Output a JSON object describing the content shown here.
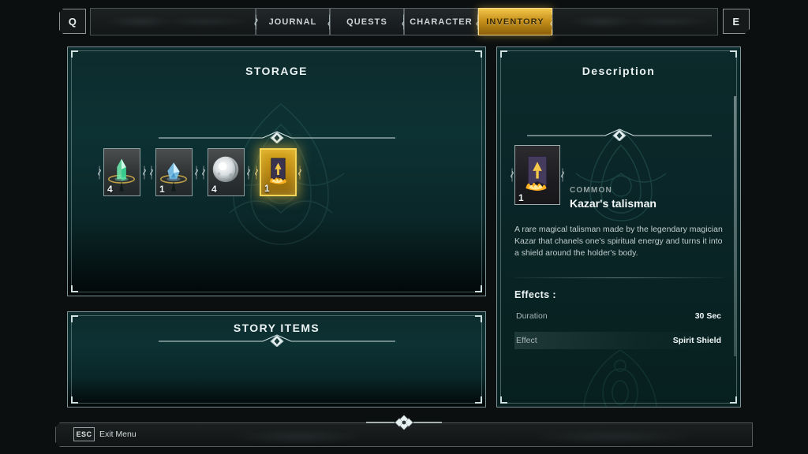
{
  "colors": {
    "panel_border": "#7e9496",
    "panel_teal_top": "#0d3234",
    "accent_gold": "#f0c64a",
    "gold_dark": "#8a5f08",
    "text_primary": "#eaf2f3",
    "text_muted": "#93a0a2",
    "background": "#0c0f10"
  },
  "topbar": {
    "left_key": "Q",
    "right_key": "E",
    "left_key_icon": "prev-tab-key",
    "right_key_icon": "next-tab-key",
    "tabs": [
      {
        "label": "JOURNAL",
        "active": false
      },
      {
        "label": "QUESTS",
        "active": false
      },
      {
        "label": "CHARACTER",
        "active": false
      },
      {
        "label": "INVENTORY",
        "active": true
      }
    ]
  },
  "storage": {
    "title": "STORAGE",
    "divider_icon": "diamond-divider",
    "slots": [
      {
        "quantity": "4",
        "art": "green-crystal",
        "selected": false
      },
      {
        "quantity": "1",
        "art": "blue-crystal",
        "selected": false
      },
      {
        "quantity": "4",
        "art": "white-moon-orb",
        "selected": false
      },
      {
        "quantity": "1",
        "art": "fire-talisman-banner",
        "selected": true
      }
    ]
  },
  "story_items": {
    "title": "STORY ITEMS",
    "divider_icon": "diamond-divider",
    "items": []
  },
  "description": {
    "title": "Description",
    "divider_icon": "diamond-divider",
    "thumbnail_art": "fire-talisman-banner",
    "thumbnail_quantity": "1",
    "rarity": "COMMON",
    "item_name": "Kazar's talisman",
    "body": "A rare magical talisman made by the legendary magician Kazar that chanels one's spiritual energy and turns it into a shield around the holder's body.",
    "effects_title": "Effects :",
    "effects": [
      {
        "key": "Duration",
        "value": "30 Sec"
      },
      {
        "key": "Effect",
        "value": "Spirit Shield"
      }
    ]
  },
  "bottombar": {
    "key": "ESC",
    "label": "Exit Menu",
    "ornament_icon": "diamond-ornament"
  }
}
